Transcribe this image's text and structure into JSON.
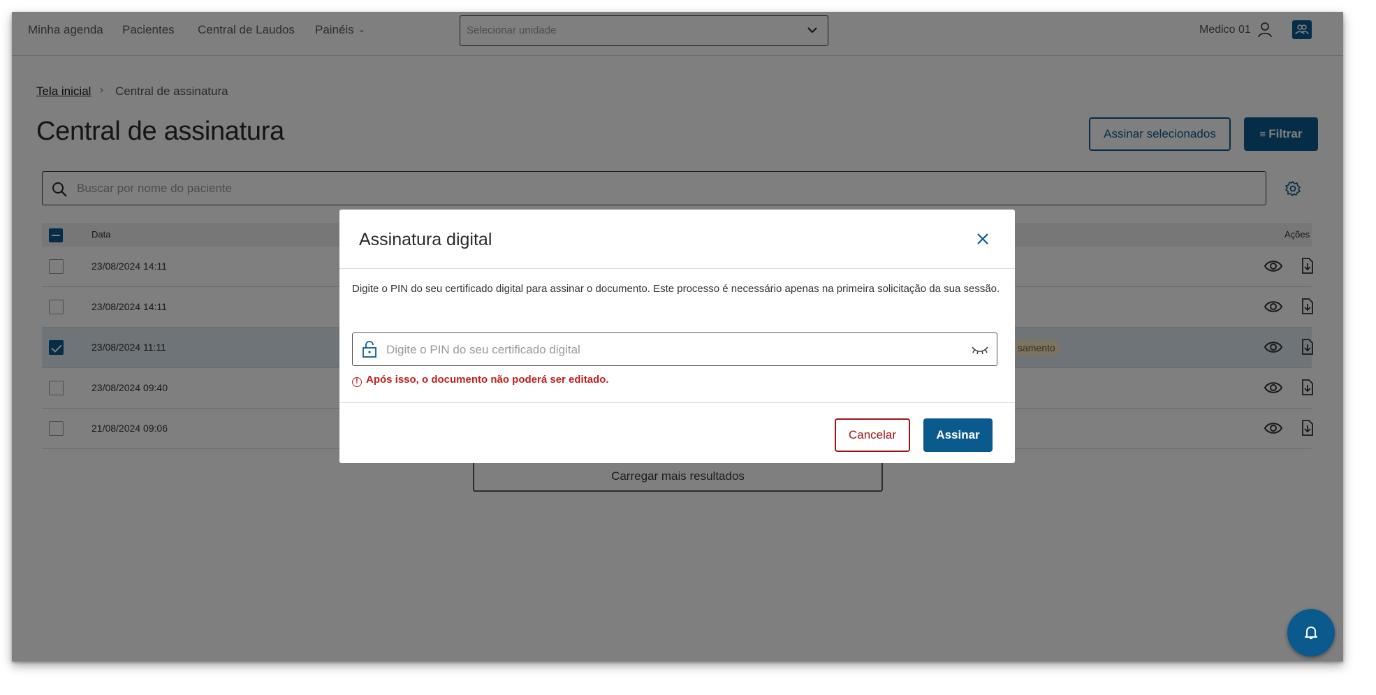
{
  "nav": {
    "items": [
      "Minha agenda",
      "Pacientes",
      "Central de Laudos",
      "Painéis"
    ],
    "unit_select_placeholder": "Selecionar unidade",
    "user_name": "Medico 01"
  },
  "breadcrumb": {
    "home": "Tela inicial",
    "current": "Central de assinatura"
  },
  "page": {
    "title": "Central de assinatura",
    "sign_selected_label": "Assinar selecionados",
    "filter_label": "Filtrar",
    "search_placeholder": "Buscar por nome do paciente"
  },
  "table": {
    "headers": {
      "date": "Data",
      "actions": "Ações"
    },
    "rows": [
      {
        "date": "23/08/2024 14:11",
        "selected": false
      },
      {
        "date": "23/08/2024 14:11",
        "selected": false
      },
      {
        "date": "23/08/2024 11:11",
        "selected": true,
        "status_badge": "samento"
      },
      {
        "date": "23/08/2024 09:40",
        "selected": false
      },
      {
        "date": "21/08/2024 09:06",
        "selected": false
      }
    ],
    "load_more_label": "Carregar mais resultados"
  },
  "modal": {
    "title": "Assinatura digital",
    "description": "Digite o PIN do seu certificado digital para assinar o documento. Este processo é necessário apenas na primeira solicitação da sua sessão.",
    "pin_placeholder": "Digite o PIN do seu certificado digital",
    "error": "Após isso, o documento não poderá ser editado.",
    "cancel_label": "Cancelar",
    "sign_label": "Assinar"
  },
  "colors": {
    "primary": "#0b5a8e",
    "danger": "#c0201f",
    "selected_row": "#dde8f0"
  }
}
